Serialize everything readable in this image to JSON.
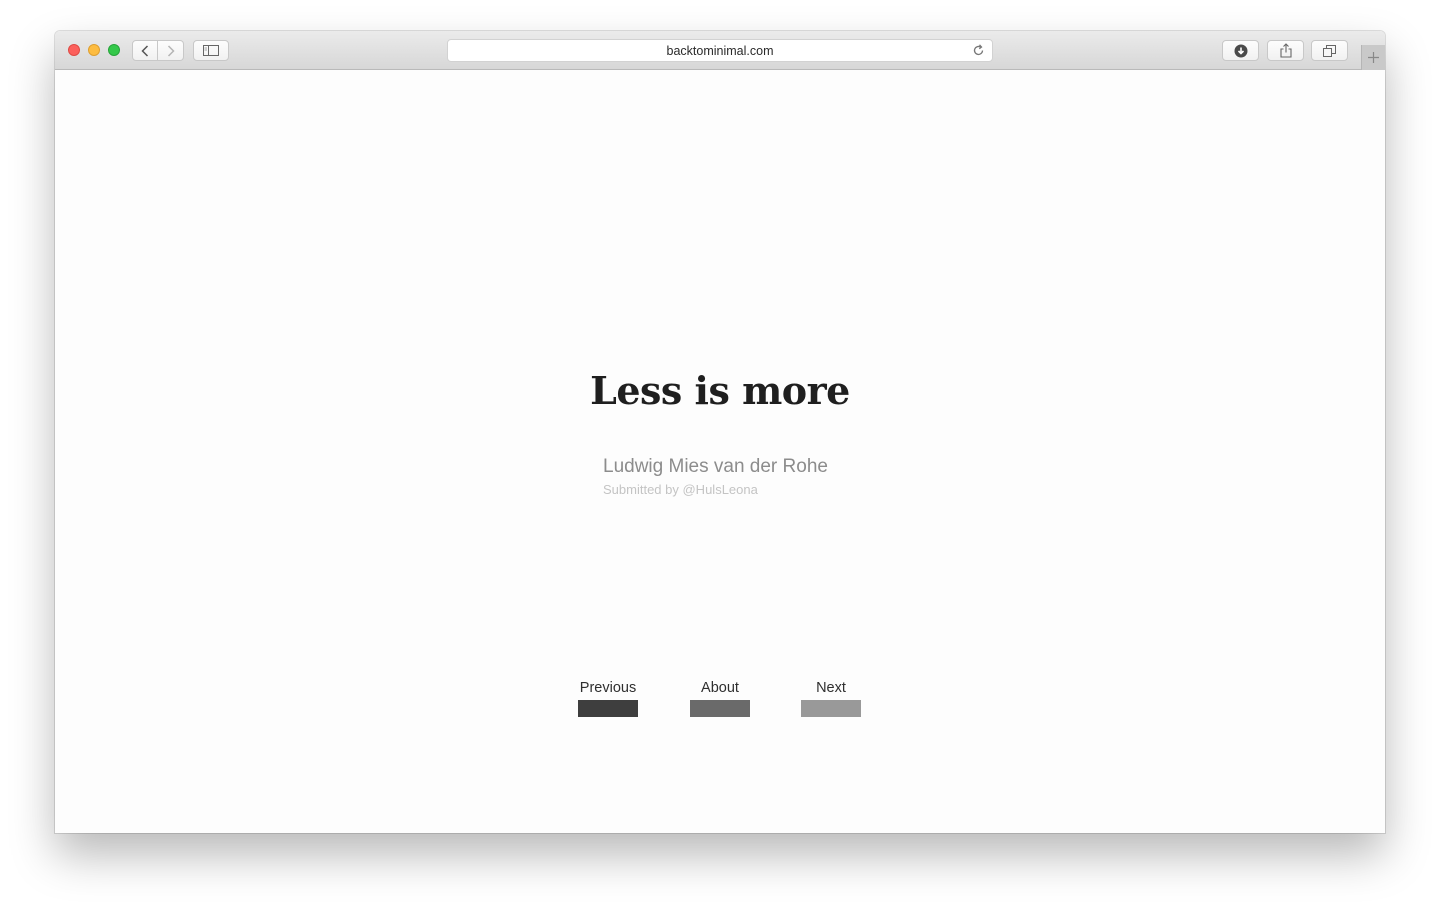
{
  "browser": {
    "address": "backtominimal.com",
    "colors": {
      "close": "#fc605c",
      "minimize": "#fdbc40",
      "maximize": "#34c84a"
    }
  },
  "page": {
    "quote": "Less is more",
    "author": "Ludwig Mies van der Rohe",
    "submitted": "Submitted by @HulsLeona"
  },
  "nav": {
    "previous": {
      "label": "Previous",
      "color": "#3e3e3e"
    },
    "about": {
      "label": "About",
      "color": "#6a6a6a"
    },
    "next": {
      "label": "Next",
      "color": "#999999"
    }
  }
}
